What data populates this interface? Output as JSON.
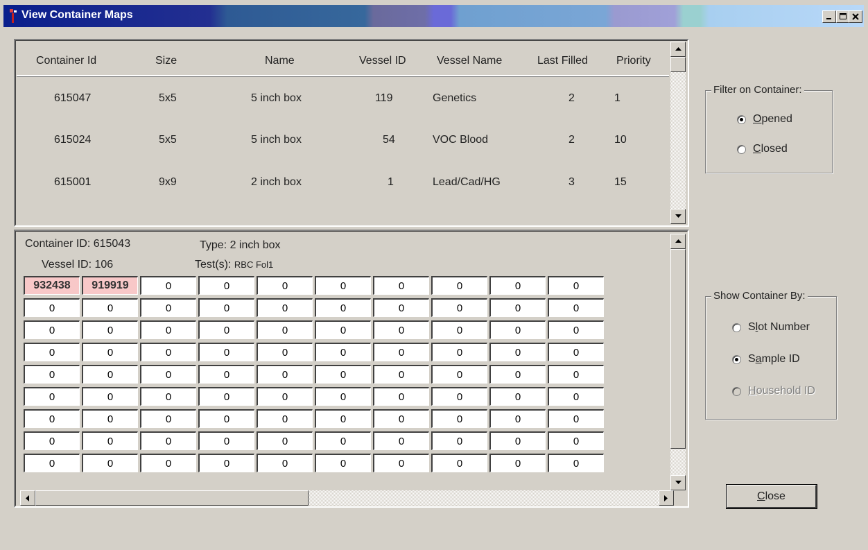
{
  "window": {
    "title": "View Container Maps",
    "buttons": {
      "minimize": "minimize-icon",
      "maximize": "maximize-icon",
      "close": "close-icon"
    }
  },
  "containers_table": {
    "columns": [
      "Container Id",
      "Size",
      "Name",
      "Vessel ID",
      "Vessel Name",
      "Last Filled",
      "Priority"
    ],
    "rows": [
      [
        "615047",
        "5x5",
        "5 inch box",
        "119",
        "Genetics",
        "2",
        "1"
      ],
      [
        "615024",
        "5x5",
        "5 inch box",
        "54",
        "VOC Blood",
        "2",
        "10"
      ],
      [
        "615001",
        "9x9",
        "2 inch box",
        "1",
        "Lead/Cad/HG",
        "3",
        "15"
      ]
    ]
  },
  "container_detail": {
    "container_id_label": "Container ID: 615043",
    "type_label": "Type: 2 inch box",
    "vessel_id_label": "Vessel ID: 106",
    "tests_label": "Test(s):",
    "tests_value": "RBC Fol1",
    "grid": [
      [
        "932438",
        "919919",
        "0",
        "0",
        "0",
        "0",
        "0",
        "0",
        "0",
        "0"
      ],
      [
        "0",
        "0",
        "0",
        "0",
        "0",
        "0",
        "0",
        "0",
        "0",
        "0"
      ],
      [
        "0",
        "0",
        "0",
        "0",
        "0",
        "0",
        "0",
        "0",
        "0",
        "0"
      ],
      [
        "0",
        "0",
        "0",
        "0",
        "0",
        "0",
        "0",
        "0",
        "0",
        "0"
      ],
      [
        "0",
        "0",
        "0",
        "0",
        "0",
        "0",
        "0",
        "0",
        "0",
        "0"
      ],
      [
        "0",
        "0",
        "0",
        "0",
        "0",
        "0",
        "0",
        "0",
        "0",
        "0"
      ],
      [
        "0",
        "0",
        "0",
        "0",
        "0",
        "0",
        "0",
        "0",
        "0",
        "0"
      ],
      [
        "0",
        "0",
        "0",
        "0",
        "0",
        "0",
        "0",
        "0",
        "0",
        "0"
      ],
      [
        "0",
        "0",
        "0",
        "0",
        "0",
        "0",
        "0",
        "0",
        "0",
        "0"
      ]
    ]
  },
  "filter_group": {
    "legend": "Filter on Container:",
    "options": [
      {
        "label_u": "O",
        "label_rest": "pened",
        "checked": true
      },
      {
        "label_u": "C",
        "label_rest": "losed",
        "checked": false
      }
    ]
  },
  "show_group": {
    "legend": "Show Container By:",
    "options": [
      {
        "label_pre": "S",
        "label_u": "l",
        "label_rest": "ot Number",
        "checked": false,
        "disabled": false
      },
      {
        "label_pre": "S",
        "label_u": "a",
        "label_rest": "mple ID",
        "checked": true,
        "disabled": false
      },
      {
        "label_pre": "",
        "label_u": "H",
        "label_rest": "ousehold ID",
        "checked": false,
        "disabled": true
      }
    ]
  },
  "close_button": {
    "label_u": "C",
    "label_rest": "lose"
  },
  "colors": {
    "filled_cell": "#f8c8c8",
    "face": "#d4d0c8"
  }
}
